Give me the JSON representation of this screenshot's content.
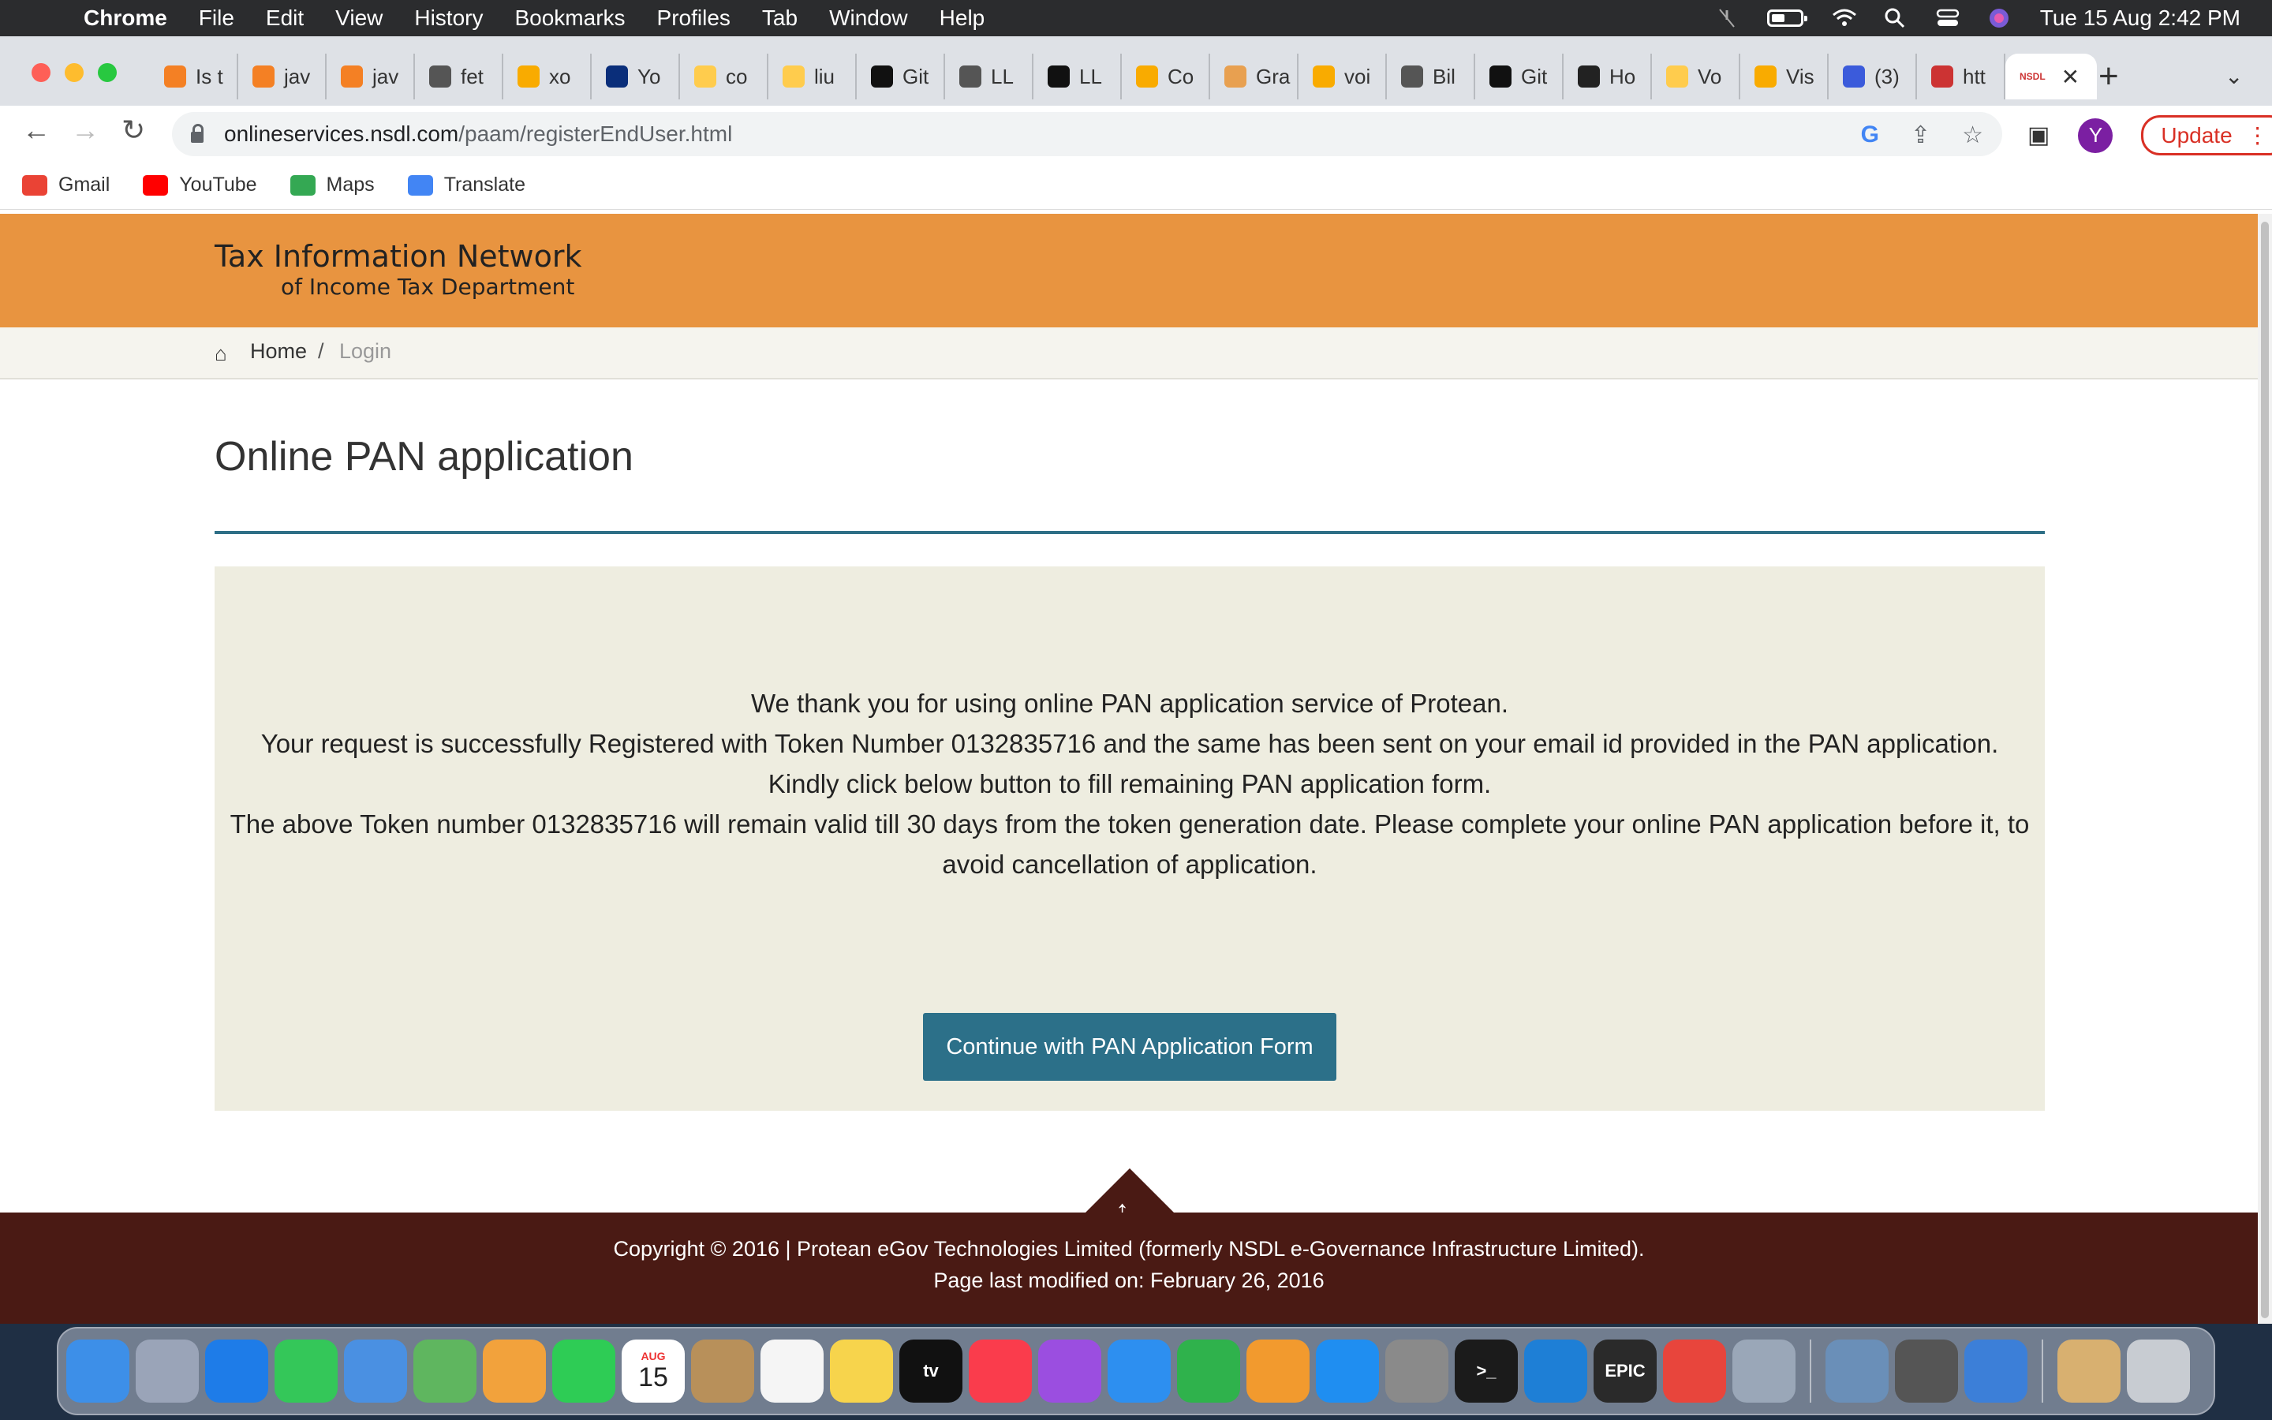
{
  "menubar": {
    "apple_icon": "apple-logo",
    "app_name": "Chrome",
    "menus": [
      "File",
      "Edit",
      "View",
      "History",
      "Bookmarks",
      "Profiles",
      "Tab",
      "Window",
      "Help"
    ],
    "datetime": "Tue 15 Aug  2:42 PM"
  },
  "tabs": [
    {
      "label": "Is t",
      "icon": "stackoverflow-icon",
      "color": "#f48024"
    },
    {
      "label": "jav",
      "icon": "stackoverflow-icon",
      "color": "#f48024"
    },
    {
      "label": "jav",
      "icon": "stackoverflow-icon",
      "color": "#f48024"
    },
    {
      "label": "fet",
      "icon": "globe-icon",
      "color": "#555555"
    },
    {
      "label": "xo",
      "icon": "colab-icon",
      "color": "#f9ab00"
    },
    {
      "label": "Yo",
      "icon": "notion-n-icon",
      "color": "#0a2e7a"
    },
    {
      "label": "co",
      "icon": "huggingface-icon",
      "color": "#ffcc4d"
    },
    {
      "label": "liu",
      "icon": "huggingface-icon",
      "color": "#ffcc4d"
    },
    {
      "label": "Git",
      "icon": "github-icon",
      "color": "#111111"
    },
    {
      "label": "LL",
      "icon": "search-icon",
      "color": "#555555"
    },
    {
      "label": "LL",
      "icon": "github-icon",
      "color": "#111111"
    },
    {
      "label": "Co",
      "icon": "colab-icon",
      "color": "#f9ab00"
    },
    {
      "label": "Gra",
      "icon": "layers-icon",
      "color": "#e8a050"
    },
    {
      "label": "voi",
      "icon": "colab-icon",
      "color": "#f9ab00"
    },
    {
      "label": "Bil",
      "icon": "globe-icon",
      "color": "#555555"
    },
    {
      "label": "Git",
      "icon": "github-icon",
      "color": "#111111"
    },
    {
      "label": "Ho",
      "icon": "news-icon",
      "color": "#222222"
    },
    {
      "label": "Vo",
      "icon": "huggingface-icon",
      "color": "#ffcc4d"
    },
    {
      "label": "Vis",
      "icon": "colab-icon",
      "color": "#f9ab00"
    },
    {
      "label": "(3)",
      "icon": "chat-icon",
      "color": "#3b5bdb"
    },
    {
      "label": "htt",
      "icon": "nsdl-icon",
      "color": "#cc3333"
    }
  ],
  "active_tab": {
    "icon_text": "NSDL",
    "close": "✕"
  },
  "toolbar": {
    "url_host": "onlineservices.nsdl.com",
    "url_path": "/paam/registerEndUser.html",
    "profile_initial": "Y",
    "update_label": "Update"
  },
  "bookmarks": [
    {
      "label": "Gmail",
      "icon": "gmail-icon",
      "color": "#ea4335"
    },
    {
      "label": "YouTube",
      "icon": "youtube-icon",
      "color": "#ff0000"
    },
    {
      "label": "Maps",
      "icon": "maps-icon",
      "color": "#34a853"
    },
    {
      "label": "Translate",
      "icon": "translate-icon",
      "color": "#4285f4"
    }
  ],
  "site": {
    "logo_line1": "Tax Information Network",
    "logo_line2": "of Income Tax Department",
    "breadcrumb_home": "Home",
    "breadcrumb_sep": "/",
    "breadcrumb_current": "Login",
    "page_title": "Online PAN application",
    "messages": [
      "We thank you for using online PAN application service of Protean.",
      "Your request is successfully Registered with Token Number 0132835716 and the same has been sent on your email id provided in the PAN application.",
      "Kindly click below button to fill remaining PAN application form.",
      "The above Token number 0132835716 will remain valid till 30 days from the token generation date. Please complete your online PAN application before it, to avoid cancellation of application."
    ],
    "cta_label": "Continue with PAN Application Form",
    "footer_line1": "Copyright © 2016 | Protean eGov Technologies Limited (formerly NSDL e-Governance Infrastructure Limited).",
    "footer_line2": "Page last modified on: February 26, 2016",
    "colors": {
      "header": "#e89440",
      "accent": "#2c7089",
      "footer": "#4a1a14",
      "message_bg": "#eeede0"
    }
  },
  "dock": [
    {
      "name": "finder-icon",
      "color": "#3d8fe8"
    },
    {
      "name": "launchpad-icon",
      "color": "#9aa4b8"
    },
    {
      "name": "safari-icon",
      "color": "#1e7ce8"
    },
    {
      "name": "messages-icon",
      "color": "#34c759"
    },
    {
      "name": "mail-icon",
      "color": "#4a90e2"
    },
    {
      "name": "maps-icon",
      "color": "#5fb65f"
    },
    {
      "name": "photos-icon",
      "color": "#f2a23c"
    },
    {
      "name": "facetime-icon",
      "color": "#2ecc55"
    },
    {
      "name": "calendar-icon",
      "color": "#ffffff"
    },
    {
      "name": "contacts-icon",
      "color": "#b8905a"
    },
    {
      "name": "reminders-icon",
      "color": "#f5f5f5"
    },
    {
      "name": "notes-icon",
      "color": "#f7d44c"
    },
    {
      "name": "appletv-icon",
      "color": "#111111"
    },
    {
      "name": "music-icon",
      "color": "#fa3c4c"
    },
    {
      "name": "podcasts-icon",
      "color": "#9b4ee0"
    },
    {
      "name": "keynote-icon",
      "color": "#2d8ff0"
    },
    {
      "name": "numbers-icon",
      "color": "#2fb24c"
    },
    {
      "name": "pages-icon",
      "color": "#f29a2e"
    },
    {
      "name": "appstore-icon",
      "color": "#1f8ef1"
    },
    {
      "name": "system-preferences-icon",
      "color": "#8a8a8a"
    },
    {
      "name": "terminal-icon",
      "color": "#1b1b1b"
    },
    {
      "name": "vscode-icon",
      "color": "#1e7fd6"
    },
    {
      "name": "epic-games-icon",
      "color": "#2a2a2a"
    },
    {
      "name": "chrome-icon",
      "color": "#e8453c"
    },
    {
      "name": "settings-gear-icon",
      "color": "#9aa7b8"
    },
    {
      "name": "preview-icon",
      "color": "#6a8fb8"
    },
    {
      "name": "calculator-icon",
      "color": "#555555"
    },
    {
      "name": "xcode-icon",
      "color": "#3c7fd8"
    },
    {
      "name": "archive-icon",
      "color": "#d8b070"
    },
    {
      "name": "trash-icon",
      "color": "#c8ccd2"
    }
  ],
  "dock_calendar": {
    "month": "AUG",
    "day": "15"
  },
  "dock_labels": {
    "appletv": "tv",
    "epic": "EPIC",
    "terminal": ">_"
  }
}
